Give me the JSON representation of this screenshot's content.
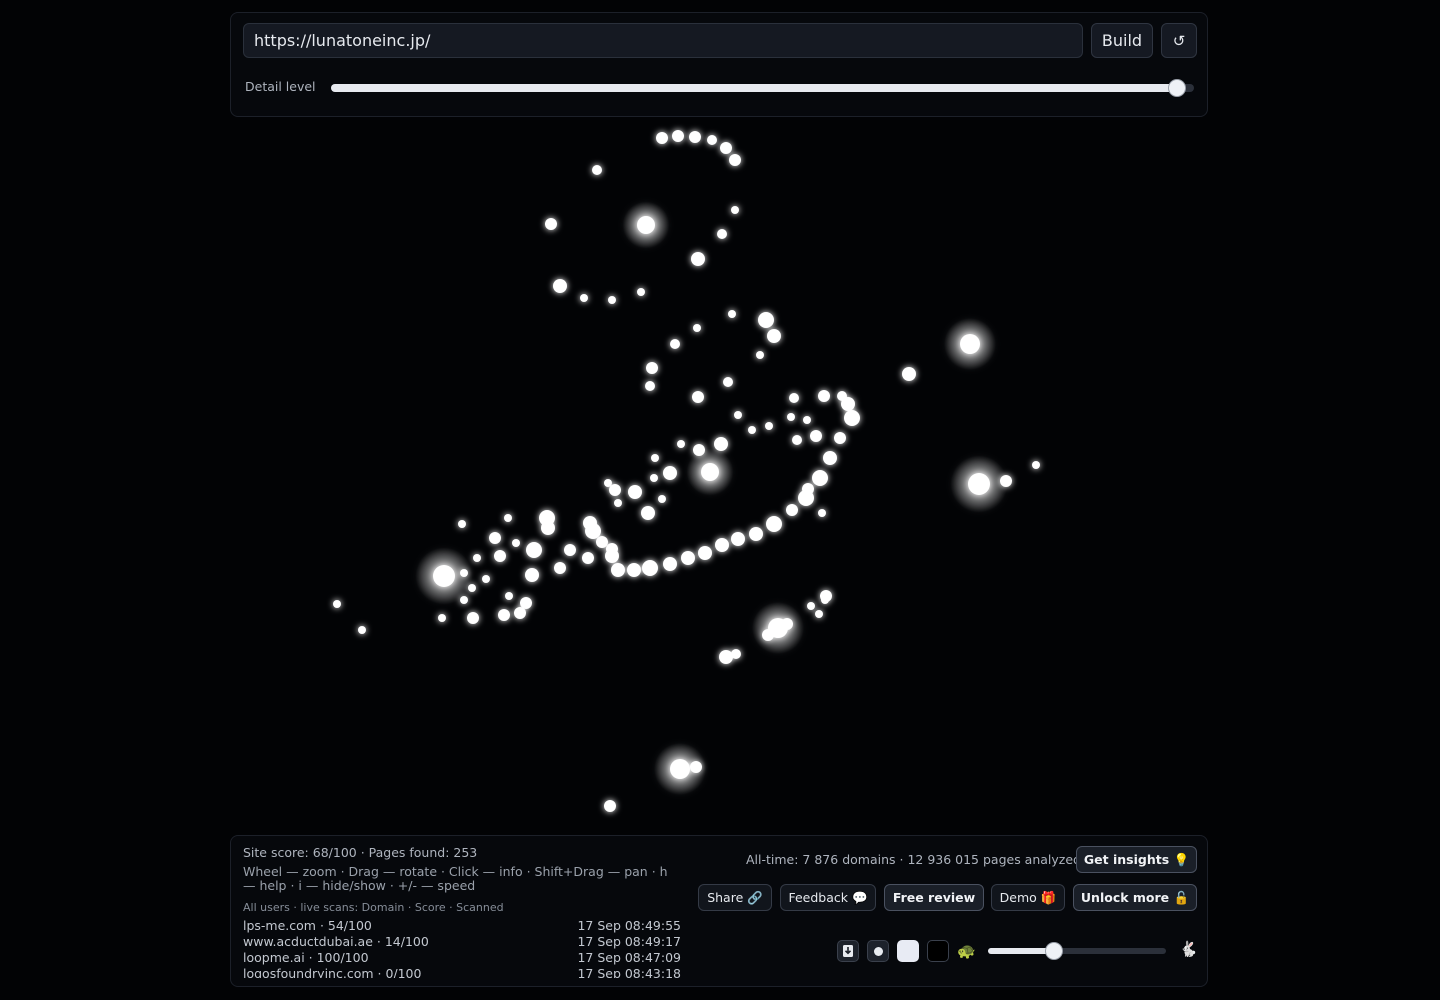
{
  "toolbar": {
    "url_value": "https://lunatoneinc.jp/",
    "build_label": "Build",
    "reset_icon": "↺",
    "detail_label": "Detail level",
    "detail_level": 0.98
  },
  "stats": {
    "site_score": "Site score: 68/100 · Pages found: 253",
    "help": "Wheel — zoom · Drag — rotate · Click — info · Shift+Drag — pan · h — help · i — hide/show · +/- — speed",
    "live_header": "All users · live scans: Domain · Score · Scanned",
    "scans": [
      {
        "domain": "lps-me.com · 54/100",
        "time": "17 Sep 08:49:55"
      },
      {
        "domain": "www.acductdubai.ae · 14/100",
        "time": "17 Sep 08:49:17"
      },
      {
        "domain": "loopme.ai · 100/100",
        "time": "17 Sep 08:47:09"
      },
      {
        "domain": "logosfoundryinc.com · 0/100",
        "time": "17 Sep 08:43:18"
      }
    ],
    "alltime": "All-time: 7 876 domains · 12 936 015 pages analyzed"
  },
  "actions": {
    "insights": "Get insights 💡",
    "share": "Share 🔗",
    "feedback": "Feedback 💬",
    "review": "Free review",
    "demo": "Demo 🎁",
    "unlock": "Unlock more 🔓"
  },
  "controls": {
    "download_icon": "download-icon",
    "turtle": "🐢",
    "rabbit": "🐇",
    "speed": 0.37
  },
  "colors": {
    "background": "#020305",
    "node": "#ffffff"
  }
}
